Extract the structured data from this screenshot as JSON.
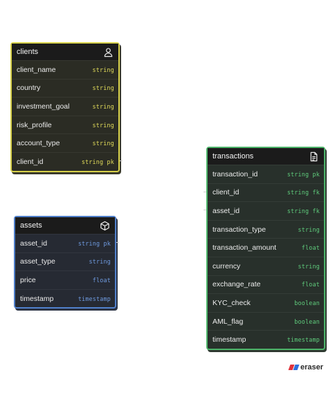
{
  "clients": {
    "title": "clients",
    "icon": "user-icon",
    "color": "#d8d24a",
    "rows": [
      {
        "name": "client_name",
        "type": "string"
      },
      {
        "name": "country",
        "type": "string"
      },
      {
        "name": "investment_goal",
        "type": "string"
      },
      {
        "name": "risk_profile",
        "type": "string"
      },
      {
        "name": "account_type",
        "type": "string"
      },
      {
        "name": "client_id",
        "type": "string pk"
      }
    ]
  },
  "assets": {
    "title": "assets",
    "icon": "cube-icon",
    "color": "#4f7fcb",
    "rows": [
      {
        "name": "asset_id",
        "type": "string pk"
      },
      {
        "name": "asset_type",
        "type": "string"
      },
      {
        "name": "price",
        "type": "float"
      },
      {
        "name": "timestamp",
        "type": "timestamp"
      }
    ]
  },
  "transactions": {
    "title": "transactions",
    "icon": "document-icon",
    "color": "#4db56a",
    "rows": [
      {
        "name": "transaction_id",
        "type": "string pk"
      },
      {
        "name": "client_id",
        "type": "string fk"
      },
      {
        "name": "asset_id",
        "type": "string fk"
      },
      {
        "name": "transaction_type",
        "type": "string"
      },
      {
        "name": "transaction_amount",
        "type": "float"
      },
      {
        "name": "currency",
        "type": "string"
      },
      {
        "name": "exchange_rate",
        "type": "float"
      },
      {
        "name": "KYC_check",
        "type": "boolean"
      },
      {
        "name": "AML_flag",
        "type": "boolean"
      },
      {
        "name": "timestamp",
        "type": "timestamp"
      }
    ]
  },
  "logo": {
    "text": "eraser",
    "colors": [
      "#e0323b",
      "#2f6fdc"
    ]
  }
}
